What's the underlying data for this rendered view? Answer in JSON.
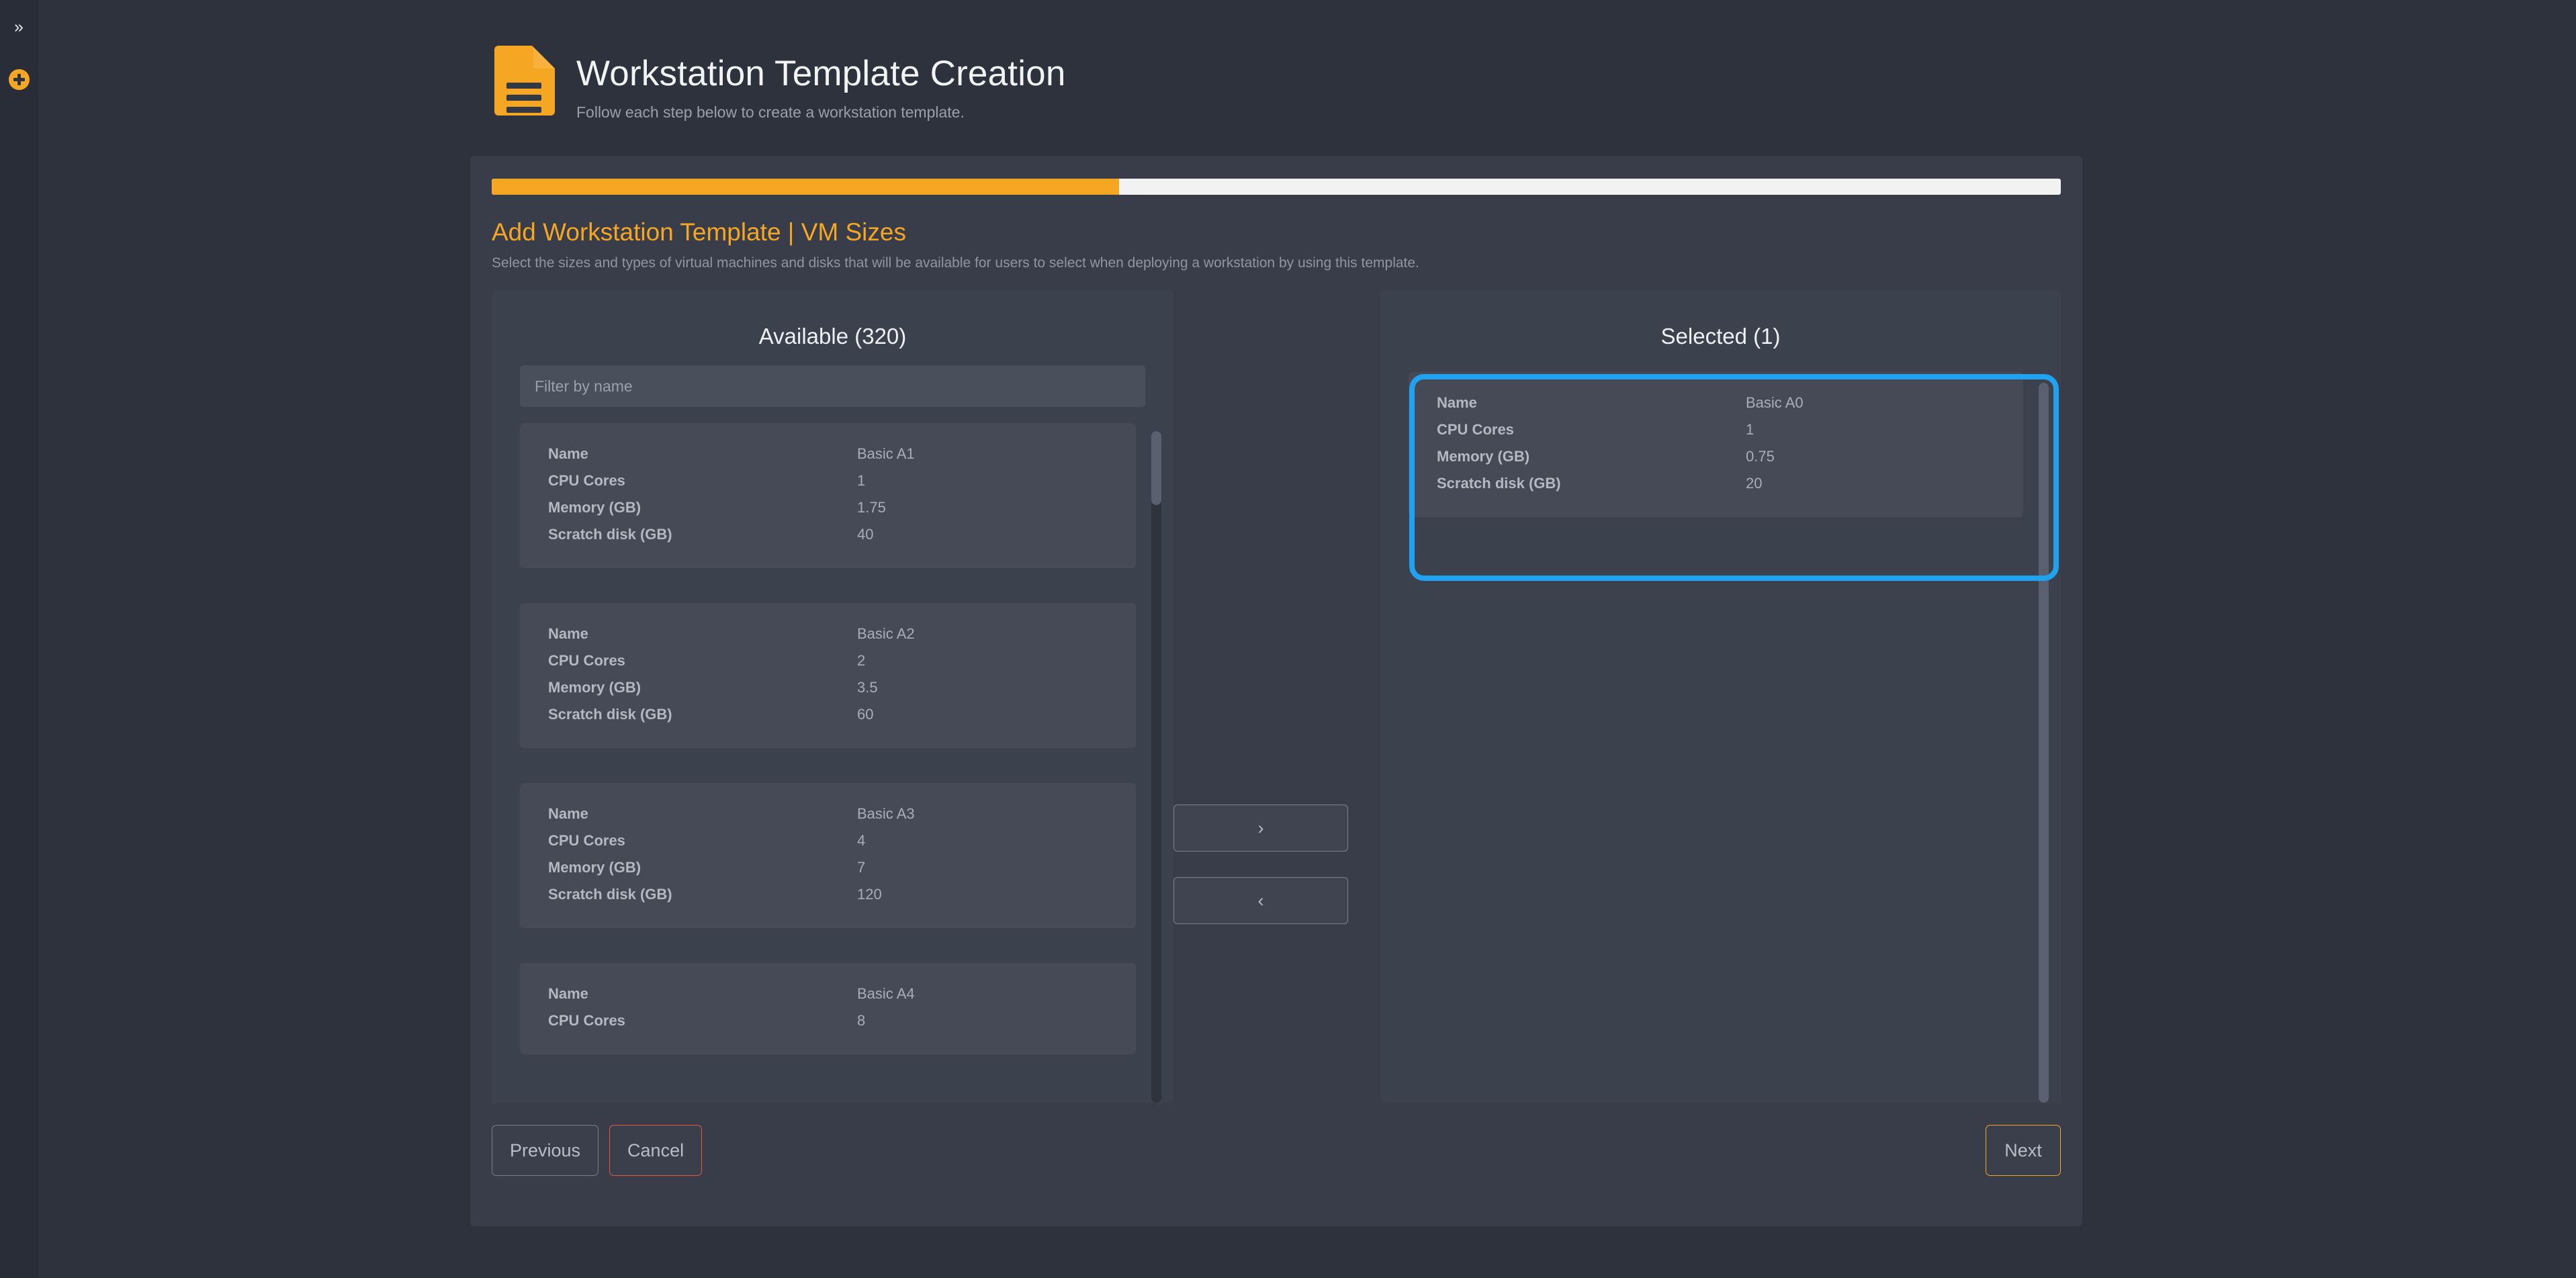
{
  "rail": {
    "expand_icon": "double-chevron-right-icon",
    "expand_glyph": "»",
    "add_icon": "plus-circle-icon"
  },
  "header": {
    "icon": "document-lines-icon",
    "title": "Workstation Template Creation",
    "subtitle": "Follow each step below to create a workstation template."
  },
  "progress": {
    "percent": 40
  },
  "section": {
    "title": "Add Workstation Template | VM Sizes",
    "description": "Select the sizes and types of virtual machines and disks that will be available for users to select when deploying a workstation by using this template."
  },
  "available": {
    "title": "Available (320)",
    "count": 320,
    "filter_placeholder": "Filter by name",
    "filter_value": "",
    "field_labels": [
      "Name",
      "CPU Cores",
      "Memory (GB)",
      "Scratch disk (GB)"
    ],
    "items": [
      {
        "name": "Basic A1",
        "cpu_cores": "1",
        "memory_gb": "1.75",
        "scratch_disk_gb": "40"
      },
      {
        "name": "Basic A2",
        "cpu_cores": "2",
        "memory_gb": "3.5",
        "scratch_disk_gb": "60"
      },
      {
        "name": "Basic A3",
        "cpu_cores": "4",
        "memory_gb": "7",
        "scratch_disk_gb": "120"
      },
      {
        "name": "Basic A4",
        "cpu_cores": "8",
        "memory_gb": "",
        "scratch_disk_gb": ""
      }
    ]
  },
  "transfer": {
    "move_right_label": "›",
    "move_left_label": "‹",
    "move_right_icon": "chevron-right-icon",
    "move_left_icon": "chevron-left-icon"
  },
  "selected": {
    "title": "Selected (1)",
    "count": 1,
    "field_labels": [
      "Name",
      "CPU Cores",
      "Memory (GB)",
      "Scratch disk (GB)"
    ],
    "items": [
      {
        "name": "Basic A0",
        "cpu_cores": "1",
        "memory_gb": "0.75",
        "scratch_disk_gb": "20"
      }
    ]
  },
  "footer": {
    "previous_label": "Previous",
    "cancel_label": "Cancel",
    "next_label": "Next"
  },
  "colors": {
    "accent_orange": "#f5a623",
    "cancel_red": "#e8563f",
    "highlight_blue": "#1fa2f0",
    "page_bg": "#2e323d",
    "card_bg": "#383d49",
    "panel_bg": "#3c414e",
    "item_bg": "#454a56"
  }
}
